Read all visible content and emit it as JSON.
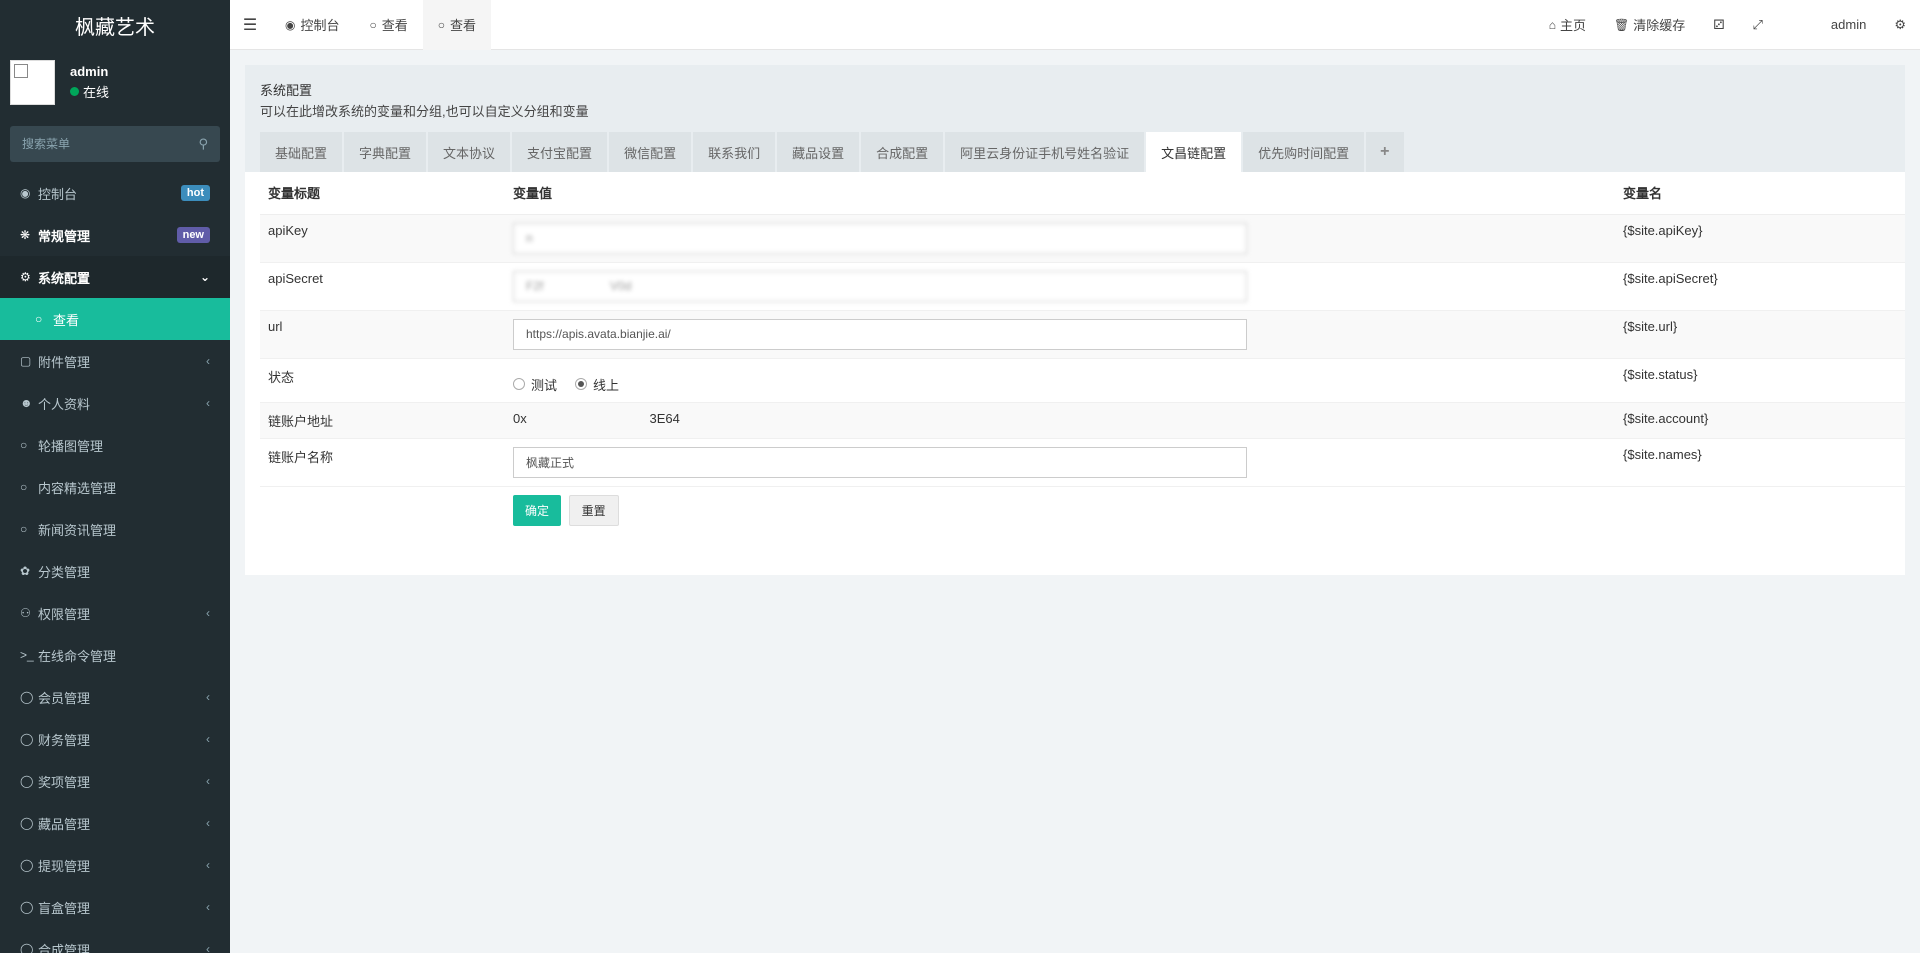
{
  "app": {
    "title": "枫藏艺术"
  },
  "user": {
    "name": "admin",
    "status": "在线"
  },
  "search": {
    "placeholder": "搜索菜单"
  },
  "sidebar": {
    "items": [
      {
        "label": "控制台",
        "icon": "dashboard-icon",
        "badge": "hot"
      },
      {
        "label": "常规管理",
        "icon": "cogs-icon",
        "badge": "new"
      },
      {
        "label": "系统配置",
        "icon": "gear-icon"
      },
      {
        "label": "查看",
        "icon": "circle-icon"
      },
      {
        "label": "附件管理",
        "icon": "paperclip-icon"
      },
      {
        "label": "个人资料",
        "icon": "user-icon"
      },
      {
        "label": "轮播图管理",
        "icon": "circle-icon"
      },
      {
        "label": "内容精选管理",
        "icon": "circle-icon"
      },
      {
        "label": "新闻资讯管理",
        "icon": "circle-icon"
      },
      {
        "label": "分类管理",
        "icon": "leaf-icon"
      },
      {
        "label": "权限管理",
        "icon": "group-icon"
      },
      {
        "label": "在线命令管理",
        "icon": "terminal-icon"
      },
      {
        "label": "会员管理",
        "icon": "circle-icon"
      },
      {
        "label": "财务管理",
        "icon": "circle-icon"
      },
      {
        "label": "奖项管理",
        "icon": "circle-icon"
      },
      {
        "label": "藏品管理",
        "icon": "circle-icon"
      },
      {
        "label": "提现管理",
        "icon": "circle-icon"
      },
      {
        "label": "盲盒管理",
        "icon": "circle-icon"
      },
      {
        "label": "合成管理",
        "icon": "circle-icon"
      }
    ]
  },
  "topbar": {
    "tabs": [
      {
        "label": "控制台"
      },
      {
        "label": "查看"
      },
      {
        "label": "查看"
      }
    ],
    "home": "主页",
    "clear_cache": "清除缓存",
    "user": "admin"
  },
  "panel": {
    "title": "系统配置",
    "description": "可以在此增改系统的变量和分组,也可以自定义分组和变量",
    "tabs": [
      "基础配置",
      "字典配置",
      "文本协议",
      "支付宝配置",
      "微信配置",
      "联系我们",
      "藏品设置",
      "合成配置",
      "阿里云身份证手机号姓名验证",
      "文昌链配置",
      "优先购时间配置"
    ],
    "add_tab": "+",
    "active_tab": 9
  },
  "table": {
    "headers": {
      "title": "变量标题",
      "value": "变量值",
      "name": "变量名"
    },
    "rows": [
      {
        "title": "apiKey",
        "value": "n",
        "name": "{$site.apiKey}"
      },
      {
        "title": "apiSecret",
        "value": "F2f                    V0d",
        "name": "{$site.apiSecret}"
      },
      {
        "title": "url",
        "value": "https://apis.avata.bianjie.ai/",
        "name": "{$site.url}"
      },
      {
        "title": "状态",
        "options": [
          "测试",
          "线上"
        ],
        "selected": 1,
        "name": "{$site.status}"
      },
      {
        "title": "链账户地址",
        "value": "0x                                  3E64",
        "name": "{$site.account}"
      },
      {
        "title": "链账户名称",
        "value": "枫藏正式",
        "name": "{$site.names}"
      }
    ]
  },
  "buttons": {
    "ok": "确定",
    "reset": "重置"
  }
}
